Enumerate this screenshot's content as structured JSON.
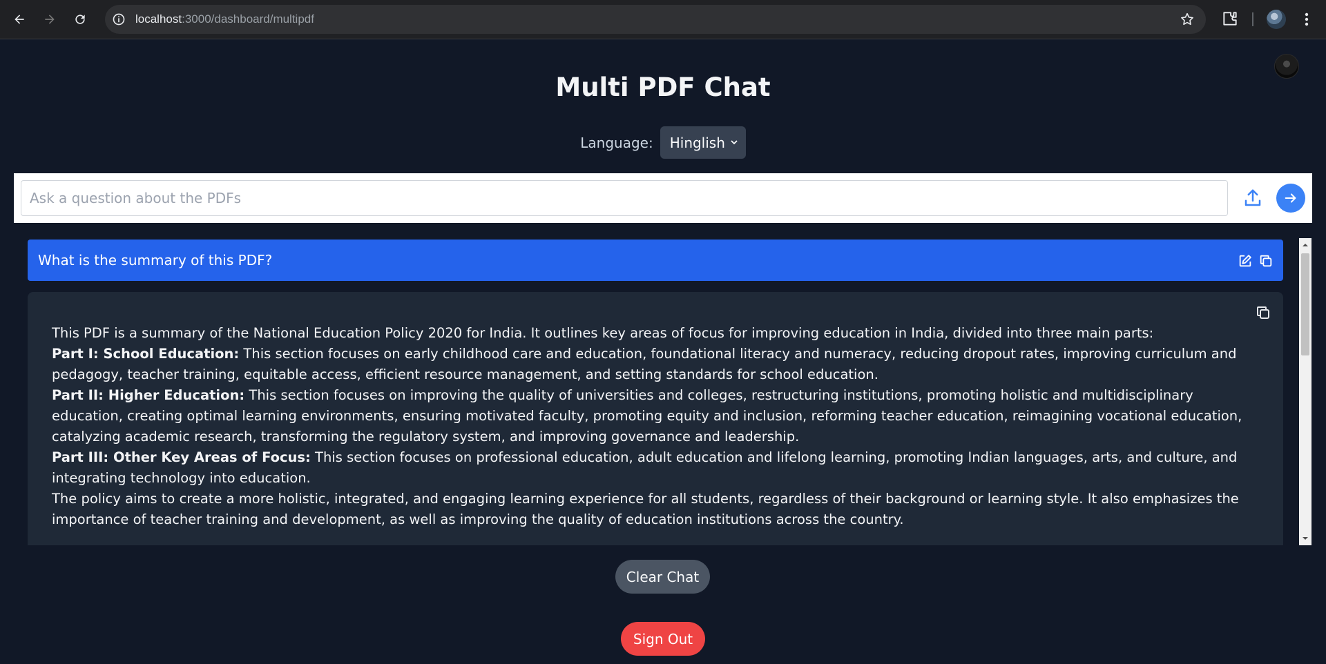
{
  "browser": {
    "url_host": "localhost",
    "url_path": ":3000/dashboard/multipdf",
    "icons": [
      "back-icon",
      "forward-icon",
      "reload-icon",
      "site-info-icon",
      "bookmark-star-icon",
      "extensions-icon",
      "profile-avatar",
      "menu-icon"
    ]
  },
  "app": {
    "title": "Multi PDF Chat",
    "language": {
      "label": "Language:",
      "selected": "Hinglish"
    },
    "search": {
      "placeholder": "Ask a question about the PDFs",
      "value": ""
    },
    "question": "What is the summary of this PDF?",
    "answer": {
      "intro": "This PDF is a summary of the National Education Policy 2020 for India. It outlines key areas of focus for improving education in India, divided into three main parts:",
      "part1_heading": "Part I: School Education:",
      "part1_text": " This section focuses on early childhood care and education, foundational literacy and numeracy, reducing dropout rates, improving curriculum and pedagogy, teacher training, equitable access, efficient resource management, and setting standards for school education.",
      "part2_heading": "Part II: Higher Education:",
      "part2_text": " This section focuses on improving the quality of universities and colleges, restructuring institutions, promoting holistic and multidisciplinary education, creating optimal learning environments, ensuring motivated faculty, promoting equity and inclusion, reforming teacher education, reimagining vocational education, catalyzing academic research, transforming the regulatory system, and improving governance and leadership.",
      "part3_heading": "Part III: Other Key Areas of Focus:",
      "part3_text": " This section focuses on professional education, adult education and lifelong learning, promoting Indian languages, arts, and culture, and integrating technology into education.",
      "conclusion": "The policy aims to create a more holistic, integrated, and engaging learning experience for all students, regardless of their background or learning style. It also emphasizes the importance of teacher training and development, as well as improving the quality of education institutions across the country."
    },
    "clear_label": "Clear Chat",
    "signout_label": "Sign Out"
  },
  "colors": {
    "background": "#111827",
    "question_bg": "#2563eb",
    "answer_bg": "#1f2937",
    "send_button": "#3b82f6",
    "clear_button": "#4b5563",
    "signout_button": "#ef4444"
  }
}
